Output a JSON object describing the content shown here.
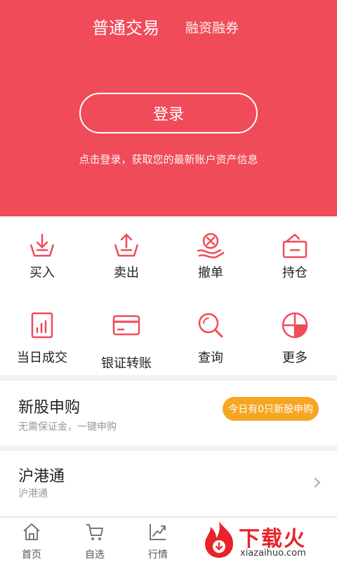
{
  "header": {
    "tab_active": "普通交易",
    "tab_inactive": "融资融券",
    "login_label": "登录",
    "hint": "点击登录，获取您的最新账户资产信息"
  },
  "functions": [
    {
      "label": "买入",
      "icon": "buy-icon"
    },
    {
      "label": "卖出",
      "icon": "sell-icon"
    },
    {
      "label": "撤单",
      "icon": "cancel-order-icon"
    },
    {
      "label": "持仓",
      "icon": "position-icon"
    },
    {
      "label": "当日成交",
      "icon": "daily-deal-icon"
    },
    {
      "label": "银证转账",
      "icon": "bank-card-icon"
    },
    {
      "label": "查询",
      "icon": "query-icon"
    },
    {
      "label": "更多",
      "icon": "more-icon"
    }
  ],
  "ipo": {
    "title": "新股申购",
    "sub": "无需保证金，一键申购",
    "badge": "今日有0只新股申购"
  },
  "hk": {
    "title": "沪港通",
    "sub": "沪港通"
  },
  "bottom_nav": [
    {
      "label": "首页",
      "icon": "home-icon"
    },
    {
      "label": "自选",
      "icon": "cart-icon"
    },
    {
      "label": "行情",
      "icon": "chart-icon"
    }
  ],
  "watermark": {
    "text": "下载火",
    "sub": "xiazaihuo.com"
  },
  "colors": {
    "accent": "#f04b58",
    "badge": "#f6a623"
  }
}
